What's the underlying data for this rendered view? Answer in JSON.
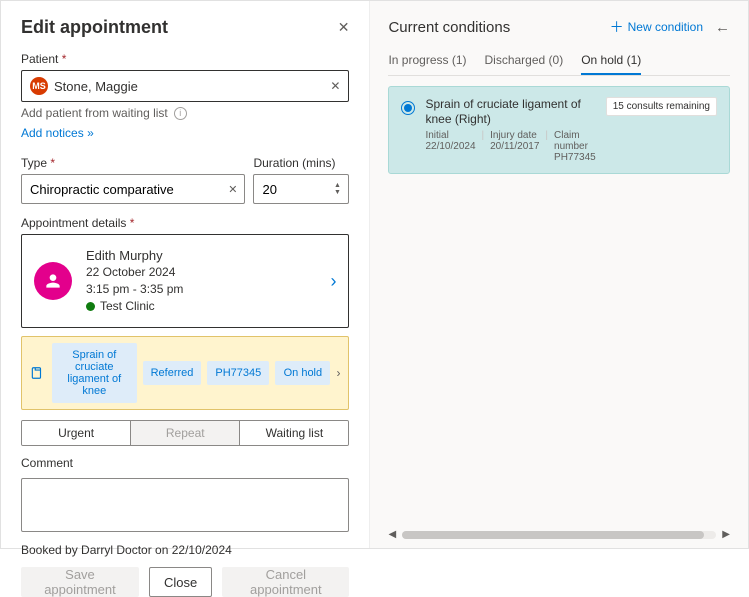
{
  "left": {
    "title": "Edit appointment",
    "patient_label": "Patient",
    "patient_initials": "MS",
    "patient_name": "Stone, Maggie",
    "waiting_list_text": "Add patient from waiting list",
    "add_notices_label": "Add notices",
    "type_label": "Type",
    "type_value": "Chiropractic comparative",
    "duration_label": "Duration (mins)",
    "duration_value": "20",
    "details_label": "Appointment details",
    "details": {
      "practitioner": "Edith Murphy",
      "date": "22 October 2024",
      "time": "3:15 pm - 3:35 pm",
      "clinic": "Test Clinic"
    },
    "tags": {
      "condition": "Sprain of cruciate ligament of knee",
      "status1": "Referred",
      "claim": "PH77345",
      "status2": "On hold"
    },
    "toggles": {
      "urgent": "Urgent",
      "repeat": "Repeat",
      "waiting": "Waiting list"
    },
    "comment_label": "Comment",
    "booked_by": "Booked by Darryl Doctor on 22/10/2024",
    "buttons": {
      "save": "Save appointment",
      "close": "Close",
      "cancel": "Cancel appointment"
    }
  },
  "right": {
    "title": "Current conditions",
    "new_condition": "New condition",
    "tabs": {
      "in_progress": "In progress (1)",
      "discharged": "Discharged (0)",
      "on_hold": "On hold (1)"
    },
    "card": {
      "title": "Sprain of cruciate ligament of knee (Right)",
      "initial": "Initial 22/10/2024",
      "injury": "Injury date 20/11/2017",
      "claim": "Claim number PH77345",
      "badge": "15 consults remaining"
    }
  }
}
